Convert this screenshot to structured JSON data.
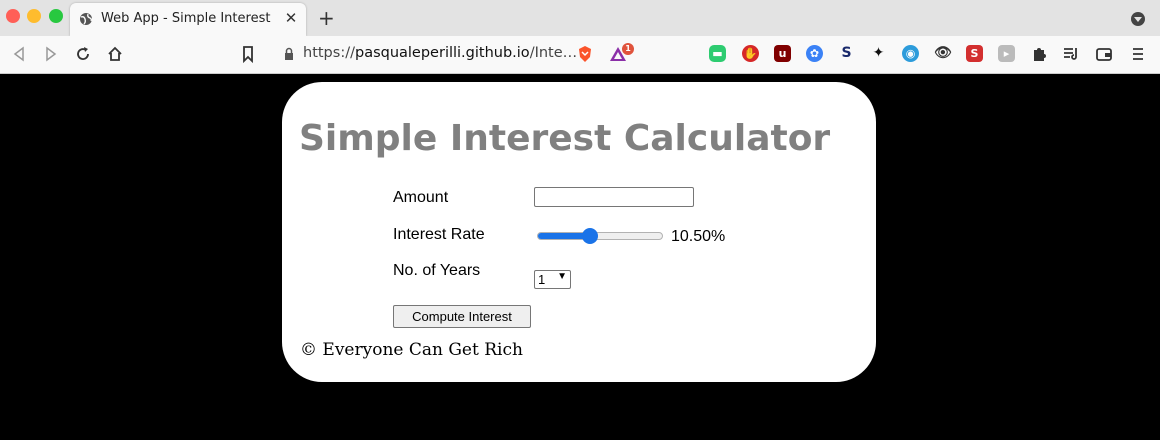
{
  "browser": {
    "tab_title": "Web App - Simple Interest Cal",
    "tab_close": "✕",
    "new_tab": "+",
    "url_prefix": "https://",
    "url_host": "pasqualeperilli.github.io",
    "url_path": "/Inte…",
    "notification_count": "1"
  },
  "app": {
    "title": "Simple Interest Calculator",
    "amount_label": "Amount",
    "amount_value": "",
    "rate_label": "Interest Rate",
    "rate_value_text": "10.50%",
    "rate_fraction": 0.42,
    "years_label": "No. of Years",
    "years_selected": "1",
    "compute_label": "Compute Interest",
    "footer": "© Everyone Can Get Rich"
  },
  "colors": {
    "title": "#808080",
    "slider_accent": "#1a73e8",
    "background": "#000000",
    "card": "#ffffff"
  }
}
